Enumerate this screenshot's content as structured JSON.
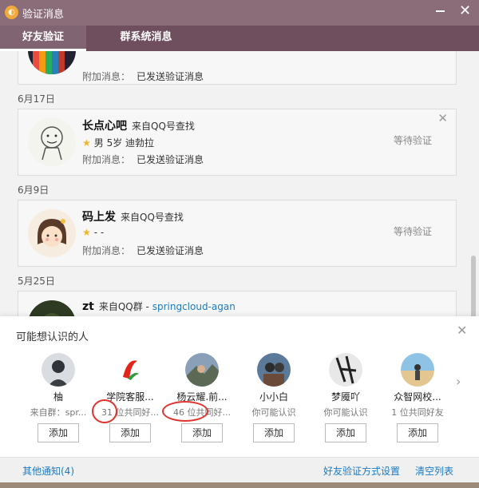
{
  "window": {
    "title": "验证消息",
    "app_icon": "qq-speaker-icon"
  },
  "tabs": [
    {
      "label": "好友验证",
      "active": true
    },
    {
      "label": "群系统消息",
      "active": false
    }
  ],
  "requests": [
    {
      "date": "",
      "name": "",
      "source": "",
      "info": "",
      "attach_label": "附加消息：",
      "attach_value": "已发送验证消息",
      "status": ""
    },
    {
      "date": "6月17日",
      "name": "长点心吧",
      "source": "来自QQ号查找",
      "info": "男 5岁 迪勃拉",
      "attach_label": "附加消息：",
      "attach_value": "已发送验证消息",
      "status": "等待验证"
    },
    {
      "date": "6月9日",
      "name": "码上发",
      "source": "来自QQ号查找",
      "info": "- -",
      "attach_label": "附加消息：",
      "attach_value": "已发送验证消息",
      "status": "等待验证"
    },
    {
      "date": "5月25日",
      "name": "zt",
      "source": "来自QQ群 - ",
      "source_link": "springcloud-agan",
      "info": "",
      "attach_label": "",
      "attach_value": "",
      "status": ""
    }
  ],
  "recommend": {
    "title": "可能想认识的人",
    "add_label": "添加",
    "people": [
      {
        "name": "柚",
        "sub": "来自群：spr..."
      },
      {
        "name": "学院客服...",
        "sub": "31 位共同好..."
      },
      {
        "name": "杨云耀.前...",
        "sub": "46 位共同好..."
      },
      {
        "name": "小小白",
        "sub": "你可能认识"
      },
      {
        "name": "梦魇吖",
        "sub": "你可能认识"
      },
      {
        "name": "众智网校...",
        "sub": "1 位共同好友"
      }
    ]
  },
  "footer": {
    "other_notices": "其他通知(4)",
    "settings": "好友验证方式设置",
    "clear": "清空列表"
  },
  "colors": {
    "titlebar": "#8b6d7a",
    "tabbar": "#6f4f5e",
    "link": "#1a7bc4",
    "annotation": "#e0332e"
  }
}
